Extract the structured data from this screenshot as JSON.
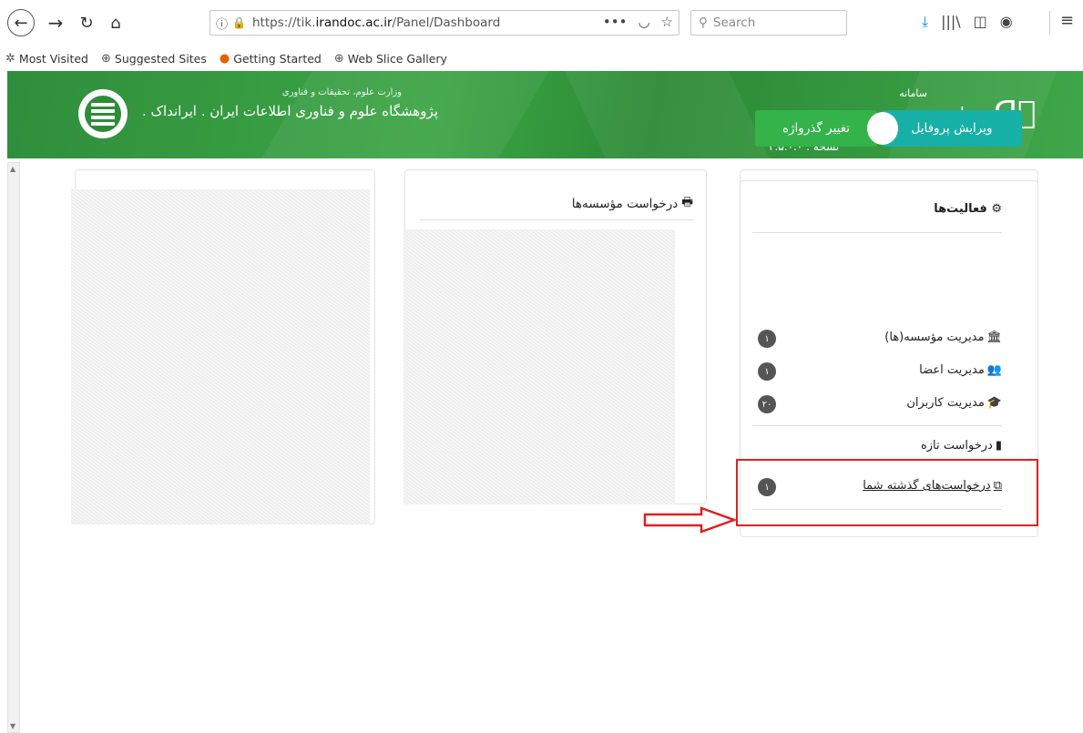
{
  "browser": {
    "url_prefix": "https://tik.",
    "url_domain": "irandoc.ac.ir",
    "url_path": "/Panel/Dashboard",
    "search_placeholder": "Search",
    "url_more": "•••",
    "bookmarks": [
      {
        "label": "Most Visited",
        "icon": "gear-icon"
      },
      {
        "label": "Suggested Sites",
        "icon": "globe-icon"
      },
      {
        "label": "Getting Started",
        "icon": "firefox-icon"
      },
      {
        "label": "Web Slice Gallery",
        "icon": "globe-icon"
      }
    ]
  },
  "header": {
    "org_small": "وزارت علوم، تحقیقات و فناوری",
    "org_name": "پژوهشگاه علوم و فناوری اطلاعات ایران  . ایرانداک .",
    "app_small": "سامانه",
    "app_name": "همانندجو",
    "version": "نسخه : ۲.۵.۰.۰"
  },
  "middle_panel": {
    "title": "درخواست مؤسسه‌ها",
    "title_icon": "printer-icon"
  },
  "buttons": {
    "edit_profile": "ویرایش پروفایل",
    "change_password": "تغییر گذرواژه"
  },
  "activities": {
    "title": "فعالیت‌ها",
    "title_icon": "gears-icon",
    "items": [
      {
        "label": "مدیریت مؤسسه(ها)",
        "icon": "bank-icon",
        "badge": "۱"
      },
      {
        "label": "مدیریت اعضا",
        "icon": "users-icon",
        "badge": "۱"
      },
      {
        "label": "مدیریت کاربران",
        "icon": "graduation-cap-icon",
        "badge": "۲۰"
      },
      {
        "label": "درخواست تازه",
        "icon": "file-icon",
        "badge": ""
      },
      {
        "label": "درخواست‌های گذشته شما",
        "icon": "copy-icon",
        "badge": "۱"
      }
    ]
  },
  "colors": {
    "banner": "#3da546",
    "profile_button": "#17b0a6",
    "password_button": "#33b34a",
    "highlight": "#e02020"
  }
}
